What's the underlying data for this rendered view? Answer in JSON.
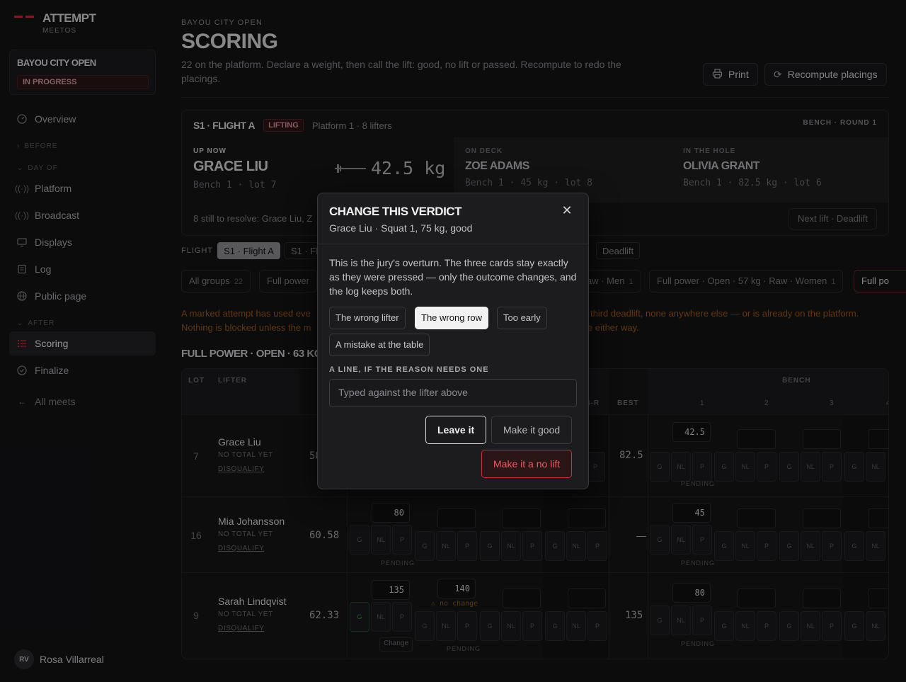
{
  "app": {
    "title": "ATTEMPT",
    "subtitle": "MEETOS"
  },
  "meet": {
    "name": "BAYOU CITY OPEN",
    "status": "IN PROGRESS"
  },
  "nav": {
    "overview": "Overview",
    "section_before": "BEFORE",
    "section_dayof": "DAY OF",
    "platform": "Platform",
    "broadcast": "Broadcast",
    "displays": "Displays",
    "log": "Log",
    "public_page": "Public page",
    "section_after": "AFTER",
    "scoring": "Scoring",
    "finalize": "Finalize",
    "all_meets": "All meets"
  },
  "user": {
    "initials": "RV",
    "name": "Rosa Villarreal"
  },
  "page": {
    "crumb": "BAYOU CITY OPEN",
    "title": "SCORING",
    "desc": "22 on the platform. Declare a weight, then call the lift: good, no lift or passed. Recompute to redo the placings.",
    "print": "Print",
    "recompute": "Recompute placings"
  },
  "flight_panel": {
    "flight": "S1 · FLIGHT A",
    "status": "LIFTING",
    "platform_info": "Platform 1 · 8 lifters",
    "lift_round": "BENCH · ROUND 1",
    "up_now_label": "UP NOW",
    "up_now_name": "GRACE LIU",
    "up_now_meta": "Bench 1 · lot 7",
    "up_now_weight": "42.5 kg",
    "on_deck_label": "ON DECK",
    "on_deck_name": "ZOE ADAMS",
    "on_deck_meta": "Bench 1 · 45 kg · lot 8",
    "in_hole_label": "IN THE HOLE",
    "in_hole_name": "OLIVIA GRANT",
    "in_hole_meta": "Bench 1 · 82.5 kg · lot 6",
    "foot": "8 still to resolve: Grace Liu, Z",
    "next_lift": "Next lift · Deadlift"
  },
  "flight_filter": {
    "label": "FLIGHT",
    "options": [
      "S1 · Flight A",
      "S1 · Flig"
    ],
    "deadlift": "Deadlift"
  },
  "groups": [
    {
      "label": "All groups",
      "count": "22"
    },
    {
      "label": "Full power",
      "count": ""
    },
    {
      "label": "aw · Men",
      "count": "1"
    },
    {
      "label": "Full power · Open · 57 kg · Raw · Women",
      "count": "1"
    },
    {
      "label": "Full po",
      "count": ""
    }
  ],
  "warning": {
    "l1a": "A marked attempt has used eve",
    "l1b": "third deadlift, none anywhere else — or is already on the platform.",
    "l2a": "Nothing is blocked unless the m",
    "l2b": "e either way."
  },
  "section_title": "FULL POWER · OPEN · 63 KG · RA",
  "table": {
    "headers": {
      "lot": "LOT",
      "lifter": "LIFTER",
      "ar": "4-R",
      "best": "BEST",
      "bench": "BENCH",
      "n1": "1",
      "n2": "2",
      "n3": "3",
      "n4": "4"
    },
    "cells": {
      "g": "G",
      "nl": "NL",
      "p": "P"
    },
    "rows": [
      {
        "lot": "7",
        "name": "Grace Liu",
        "note": "NO TOTAL YET",
        "dq": "DISQUALIFY",
        "bw": "58",
        "best": "82.5",
        "bench1": "42.5",
        "status": "PENDING"
      },
      {
        "lot": "16",
        "name": "Mia Johansson",
        "note": "NO TOTAL YET",
        "dq": "DISQUALIFY",
        "bw": "60.58",
        "squat1": "80",
        "squat_status": "PENDING",
        "best": "—",
        "bench1": "45",
        "status": "PENDING"
      },
      {
        "lot": "9",
        "name": "Sarah Lindqvist",
        "note": "NO TOTAL YET",
        "dq": "DISQUALIFY",
        "bw": "62.33",
        "squat1": "135",
        "squat2": "140",
        "squat2_note": "⚠ no change",
        "change": "Change",
        "squat_status": "PENDING",
        "best": "135",
        "bench1": "80",
        "status": "PENDING"
      }
    ]
  },
  "modal": {
    "title": "CHANGE THIS VERDICT",
    "subtitle": "Grace Liu · Squat 1, 75 kg, good",
    "body": "This is the jury's overturn. The three cards stay exactly as they were pressed — only the outcome changes, and the log keeps both.",
    "reasons": [
      "The wrong lifter",
      "The wrong row",
      "Too early",
      "A mistake at the table"
    ],
    "selected_reason": "The wrong row",
    "input_label": "A LINE, IF THE REASON NEEDS ONE",
    "input_placeholder": "Typed against the lifter above",
    "leave": "Leave it",
    "make_good": "Make it good",
    "make_no_lift": "Make it a no lift"
  },
  "colors": {
    "accent": "#c9303a",
    "warning": "#9a5a20",
    "bg": "#141416"
  }
}
